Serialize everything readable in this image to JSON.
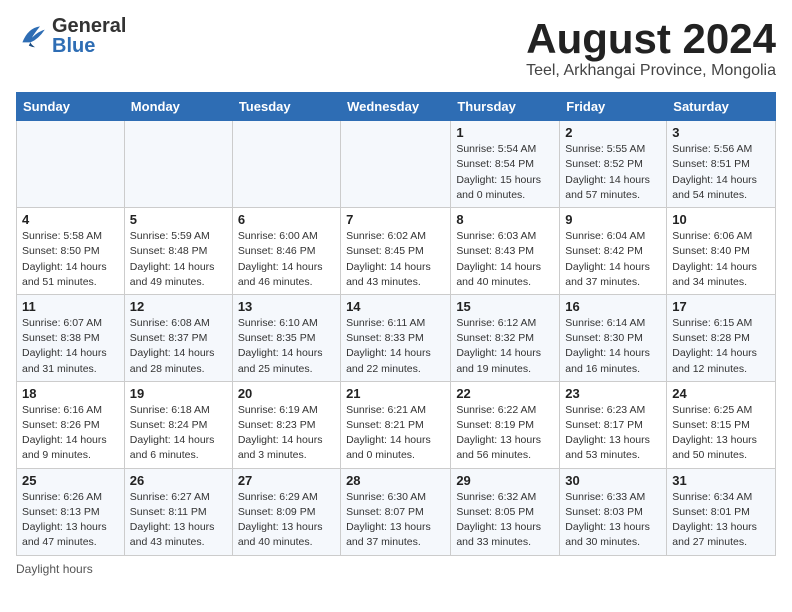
{
  "header": {
    "logo_general": "General",
    "logo_blue": "Blue",
    "title": "August 2024",
    "subtitle": "Teel, Arkhangai Province, Mongolia"
  },
  "days_of_week": [
    "Sunday",
    "Monday",
    "Tuesday",
    "Wednesday",
    "Thursday",
    "Friday",
    "Saturday"
  ],
  "footer": {
    "daylight_hours": "Daylight hours"
  },
  "weeks": [
    [
      {
        "day": "",
        "info": ""
      },
      {
        "day": "",
        "info": ""
      },
      {
        "day": "",
        "info": ""
      },
      {
        "day": "",
        "info": ""
      },
      {
        "day": "1",
        "info": "Sunrise: 5:54 AM\nSunset: 8:54 PM\nDaylight: 15 hours\nand 0 minutes."
      },
      {
        "day": "2",
        "info": "Sunrise: 5:55 AM\nSunset: 8:52 PM\nDaylight: 14 hours\nand 57 minutes."
      },
      {
        "day": "3",
        "info": "Sunrise: 5:56 AM\nSunset: 8:51 PM\nDaylight: 14 hours\nand 54 minutes."
      }
    ],
    [
      {
        "day": "4",
        "info": "Sunrise: 5:58 AM\nSunset: 8:50 PM\nDaylight: 14 hours\nand 51 minutes."
      },
      {
        "day": "5",
        "info": "Sunrise: 5:59 AM\nSunset: 8:48 PM\nDaylight: 14 hours\nand 49 minutes."
      },
      {
        "day": "6",
        "info": "Sunrise: 6:00 AM\nSunset: 8:46 PM\nDaylight: 14 hours\nand 46 minutes."
      },
      {
        "day": "7",
        "info": "Sunrise: 6:02 AM\nSunset: 8:45 PM\nDaylight: 14 hours\nand 43 minutes."
      },
      {
        "day": "8",
        "info": "Sunrise: 6:03 AM\nSunset: 8:43 PM\nDaylight: 14 hours\nand 40 minutes."
      },
      {
        "day": "9",
        "info": "Sunrise: 6:04 AM\nSunset: 8:42 PM\nDaylight: 14 hours\nand 37 minutes."
      },
      {
        "day": "10",
        "info": "Sunrise: 6:06 AM\nSunset: 8:40 PM\nDaylight: 14 hours\nand 34 minutes."
      }
    ],
    [
      {
        "day": "11",
        "info": "Sunrise: 6:07 AM\nSunset: 8:38 PM\nDaylight: 14 hours\nand 31 minutes."
      },
      {
        "day": "12",
        "info": "Sunrise: 6:08 AM\nSunset: 8:37 PM\nDaylight: 14 hours\nand 28 minutes."
      },
      {
        "day": "13",
        "info": "Sunrise: 6:10 AM\nSunset: 8:35 PM\nDaylight: 14 hours\nand 25 minutes."
      },
      {
        "day": "14",
        "info": "Sunrise: 6:11 AM\nSunset: 8:33 PM\nDaylight: 14 hours\nand 22 minutes."
      },
      {
        "day": "15",
        "info": "Sunrise: 6:12 AM\nSunset: 8:32 PM\nDaylight: 14 hours\nand 19 minutes."
      },
      {
        "day": "16",
        "info": "Sunrise: 6:14 AM\nSunset: 8:30 PM\nDaylight: 14 hours\nand 16 minutes."
      },
      {
        "day": "17",
        "info": "Sunrise: 6:15 AM\nSunset: 8:28 PM\nDaylight: 14 hours\nand 12 minutes."
      }
    ],
    [
      {
        "day": "18",
        "info": "Sunrise: 6:16 AM\nSunset: 8:26 PM\nDaylight: 14 hours\nand 9 minutes."
      },
      {
        "day": "19",
        "info": "Sunrise: 6:18 AM\nSunset: 8:24 PM\nDaylight: 14 hours\nand 6 minutes."
      },
      {
        "day": "20",
        "info": "Sunrise: 6:19 AM\nSunset: 8:23 PM\nDaylight: 14 hours\nand 3 minutes."
      },
      {
        "day": "21",
        "info": "Sunrise: 6:21 AM\nSunset: 8:21 PM\nDaylight: 14 hours\nand 0 minutes."
      },
      {
        "day": "22",
        "info": "Sunrise: 6:22 AM\nSunset: 8:19 PM\nDaylight: 13 hours\nand 56 minutes."
      },
      {
        "day": "23",
        "info": "Sunrise: 6:23 AM\nSunset: 8:17 PM\nDaylight: 13 hours\nand 53 minutes."
      },
      {
        "day": "24",
        "info": "Sunrise: 6:25 AM\nSunset: 8:15 PM\nDaylight: 13 hours\nand 50 minutes."
      }
    ],
    [
      {
        "day": "25",
        "info": "Sunrise: 6:26 AM\nSunset: 8:13 PM\nDaylight: 13 hours\nand 47 minutes."
      },
      {
        "day": "26",
        "info": "Sunrise: 6:27 AM\nSunset: 8:11 PM\nDaylight: 13 hours\nand 43 minutes."
      },
      {
        "day": "27",
        "info": "Sunrise: 6:29 AM\nSunset: 8:09 PM\nDaylight: 13 hours\nand 40 minutes."
      },
      {
        "day": "28",
        "info": "Sunrise: 6:30 AM\nSunset: 8:07 PM\nDaylight: 13 hours\nand 37 minutes."
      },
      {
        "day": "29",
        "info": "Sunrise: 6:32 AM\nSunset: 8:05 PM\nDaylight: 13 hours\nand 33 minutes."
      },
      {
        "day": "30",
        "info": "Sunrise: 6:33 AM\nSunset: 8:03 PM\nDaylight: 13 hours\nand 30 minutes."
      },
      {
        "day": "31",
        "info": "Sunrise: 6:34 AM\nSunset: 8:01 PM\nDaylight: 13 hours\nand 27 minutes."
      }
    ]
  ]
}
